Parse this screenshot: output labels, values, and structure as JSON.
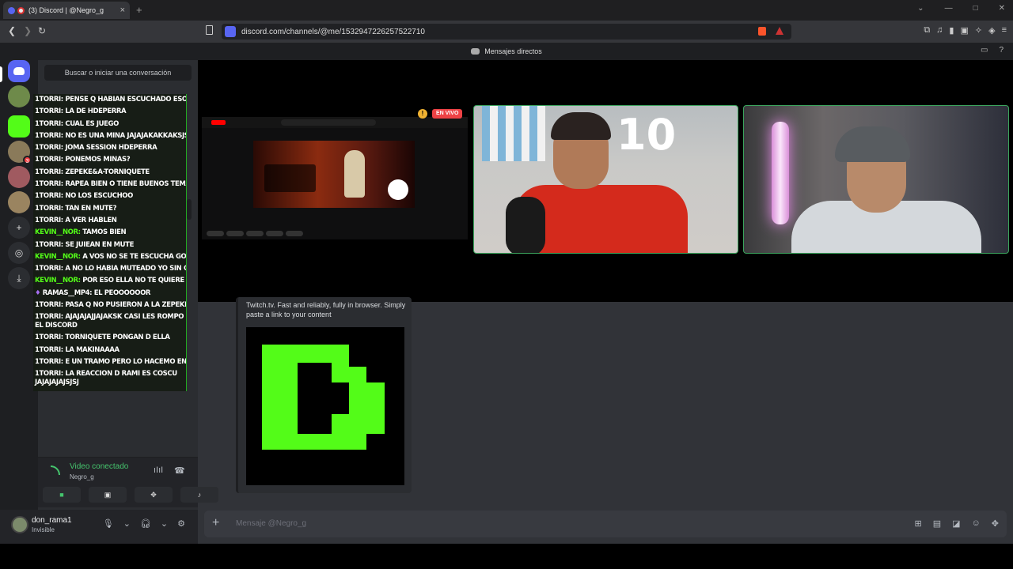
{
  "browser": {
    "tab_title": "(3) Discord | @Negro_g",
    "url": "discord.com/channels/@me/1532947226257522710"
  },
  "discord": {
    "window_title": "Mensajes directos",
    "search_placeholder": "Buscar o iniciar una conversación",
    "voice": {
      "status": "Video conectado",
      "channel": "Negro_g"
    },
    "user": {
      "name": "don_rama1",
      "status": "Invisible"
    },
    "message_placeholder": "Mensaje @Negro_g",
    "embed_description": "Twitch.tv. Fast and reliably, fully in browser. Simply paste a link to your content",
    "live_label": "EN VIVO",
    "warn_symbol": "!",
    "badge_count": "3"
  },
  "chat": [
    {
      "user": "1TORRI:",
      "msg": "PENSE Q HABIAN ESCUCHADO ESO D ALKOY",
      "color": "white"
    },
    {
      "user": "1TORRI:",
      "msg": "LA DE HDEPERRA",
      "color": "white"
    },
    {
      "user": "1TORRI:",
      "msg": "CUAL ES JUEGO",
      "color": "white"
    },
    {
      "user": "1TORRI:",
      "msg": "NO ES UNA MINA JAJAJAKAKKAKSJSJ",
      "color": "white"
    },
    {
      "user": "1TORRI:",
      "msg": "JOMA SESSION HDEPERRA",
      "color": "white"
    },
    {
      "user": "1TORRI:",
      "msg": "PONEMOS MINAS?",
      "color": "white"
    },
    {
      "user": "1TORRI:",
      "msg": "ZEPEKE&A-TORNIQUETE",
      "color": "white"
    },
    {
      "user": "1TORRI:",
      "msg": "RAPEA BIEN O TIENE BUENOS TEMAS?",
      "color": "white"
    },
    {
      "user": "1TORRI:",
      "msg": "NO LOS ESCUCHOO",
      "color": "white"
    },
    {
      "user": "1TORRI:",
      "msg": "TAN EN MUTE?",
      "color": "white"
    },
    {
      "user": "1TORRI:",
      "msg": "A VER HABLEN",
      "color": "white"
    },
    {
      "user": "KEVIN__NOR:",
      "msg": "TAMOS BIEN",
      "color": "green"
    },
    {
      "user": "1TORRI:",
      "msg": "SE JUIEAN EN MUTE",
      "color": "white"
    },
    {
      "user": "KEVIN__NOR:",
      "msg": "A VOS NO SE TE ESCUCHA GOVIR",
      "color": "green"
    },
    {
      "user": "1TORRI:",
      "msg": "A NO LO HABIA MUTEADO YO SIN QUERER",
      "color": "white"
    },
    {
      "user": "KEVIN__NOR:",
      "msg": "POR ESO ELLA NO TE QUIERE",
      "color": "green"
    },
    {
      "user": "RAMAS__MP4:",
      "msg": "EL PEOOOOOOR",
      "color": "purple"
    },
    {
      "user": "1TORRI:",
      "msg": "PASA Q NO PUSIERON A LA ZEPEKE&A",
      "color": "white"
    },
    {
      "user": "1TORRI:",
      "msg": "AJAJAJAJJAJAKSK CASI LES ROMPO EL DISCORD",
      "color": "white",
      "wrap": true
    },
    {
      "user": "1TORRI:",
      "msg": "TORNIQUETE PONGAN D ELLA",
      "color": "white"
    },
    {
      "user": "1TORRI:",
      "msg": "LA MAKINAAAA",
      "color": "white"
    },
    {
      "user": "1TORRI:",
      "msg": "E UN TRAMO PERO LO HACEMO EN UN TIRO",
      "color": "white"
    },
    {
      "user": "1TORRI:",
      "msg": "LA REACCION D RAMI ES COSCU JAJAJAJAJSJSJ",
      "color": "white",
      "wrap": true
    }
  ],
  "colors": {
    "accent": "#5865f2",
    "connected": "#45c46d",
    "kick_green": "#53fc18",
    "live_red": "#ed4245"
  },
  "icons": [
    "discord-logo-icon",
    "plus-icon",
    "compass-icon",
    "download-icon",
    "mic-icon",
    "headphones-icon",
    "gear-icon",
    "camera-icon",
    "screen-share-icon",
    "activity-icon",
    "soundboard-icon",
    "disconnect-icon",
    "gift-icon",
    "gif-icon",
    "sticker-icon",
    "emoji-icon",
    "apps-icon"
  ]
}
